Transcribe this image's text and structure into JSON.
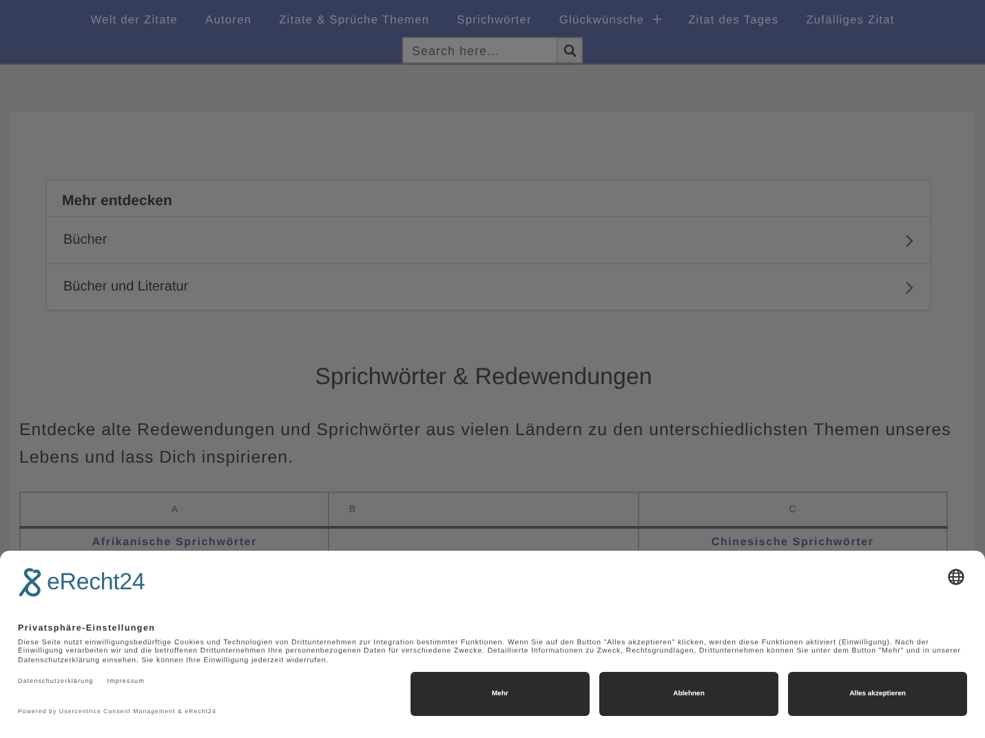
{
  "nav": {
    "items": [
      {
        "label": "Welt der Zitate",
        "has_submenu": false
      },
      {
        "label": "Autoren",
        "has_submenu": false
      },
      {
        "label": "Zitate & Sprüche Themen",
        "has_submenu": false
      },
      {
        "label": "Sprichwörter",
        "has_submenu": false
      },
      {
        "label": "Glückwünsche",
        "has_submenu": true
      },
      {
        "label": "Zitat des Tages",
        "has_submenu": false
      },
      {
        "label": "Zufälliges Zitat",
        "has_submenu": false
      }
    ],
    "search": {
      "placeholder": "Search here..."
    }
  },
  "discover": {
    "title": "Mehr entdecken",
    "items": [
      "Bücher",
      "Bücher und Literatur"
    ]
  },
  "content": {
    "title": "Sprichwörter & Redewendungen",
    "intro": "Entdecke alte Redewendungen und Sprichwörter aus vielen Ländern zu den unterschiedlichsten Themen unseres Lebens und lass Dich inspirieren.",
    "table": {
      "columns": [
        "A",
        "B",
        "C"
      ],
      "rows": [
        [
          "Afrikanische Sprichwörter",
          "",
          "Chinesische Sprichwörter"
        ]
      ]
    }
  },
  "consent": {
    "logo": "eRecht24",
    "heading": "Privatsphäre-Einstellungen",
    "text": "Diese Seite nutzt einwilligungsbedürftige Cookies und Technologien von Drittunternehmen zur Integration bestimmter Funktionen. Wenn Sie auf den Button \"Alles akzeptieren\" klicken, werden diese Funktionen aktiviert (Einwilligung). Nach der Einwilligung verarbeiten wir und die betroffenen Drittunternehmen Ihre personenbezogenen Daten für verschiedene Zwecke. Detaillierte Informationen zu Zweck, Rechtsgrundlagen, Drittunternehmen können Sie unter dem Button \"Mehr\" und in unserer Datenschutzerklärung einsehen. Sie können Ihre Einwilligung jederzeit widerrufen.",
    "links": [
      "Datenschutzerklärung",
      "Impressum"
    ],
    "powered": "Powered by Usercentrics Consent Management & eRecht24",
    "buttons": [
      "Mehr",
      "Ablehnen",
      "Alles akzeptieren"
    ]
  }
}
